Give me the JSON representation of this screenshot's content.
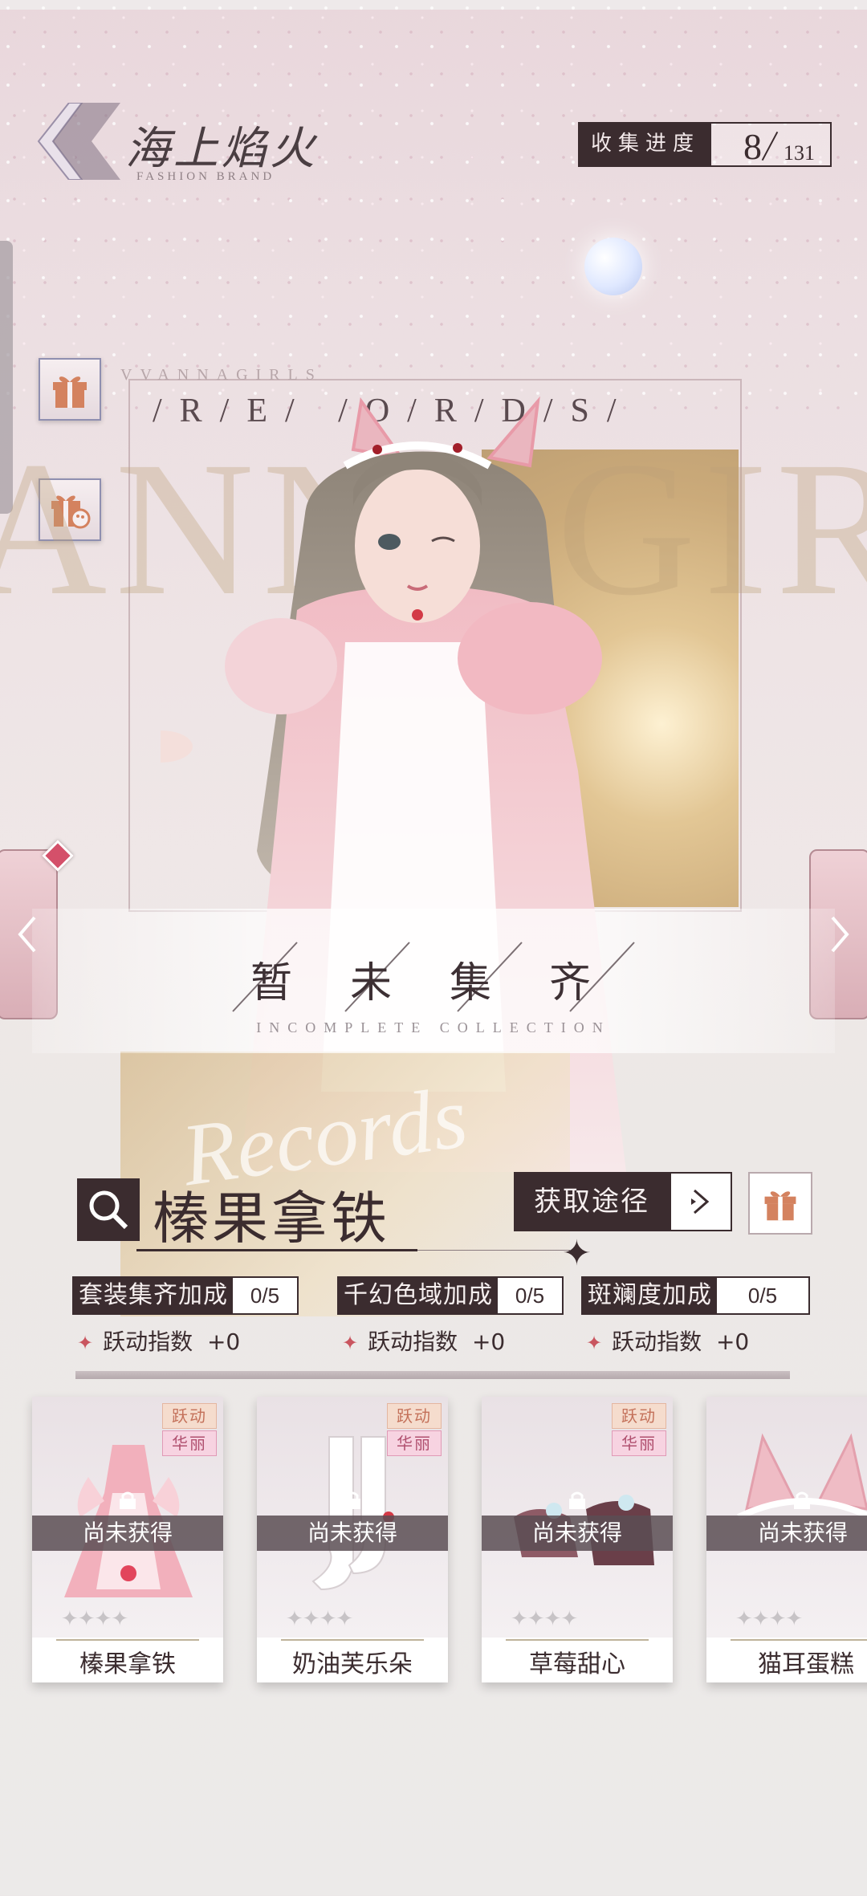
{
  "header": {
    "brand_title": "海上焰火",
    "brand_subtitle": "FASHION BRAND",
    "progress_label": "收集进度",
    "progress_current": "8",
    "progress_total": "131"
  },
  "banner": {
    "top_small": "VVANNAGIRLS",
    "records": "/R/E/ /O/R/D/S/",
    "big_letters": "ANNAGIR",
    "status_title": "暂未集齐",
    "status_subtitle": "INCOMPLETE   COLLECTION",
    "script_word": "Records"
  },
  "suit": {
    "name": "榛果拿铁",
    "obtain_label": "获取途径"
  },
  "bonuses": [
    {
      "label": "套装集齐加成",
      "value": "0/5",
      "sub_label": "跃动指数",
      "sub_value": "+0"
    },
    {
      "label": "千幻色域加成",
      "value": "0/5",
      "sub_label": "跃动指数",
      "sub_value": "+0"
    },
    {
      "label": "斑斓度加成",
      "value": "0/5",
      "sub_label": "跃动指数",
      "sub_value": "+0"
    }
  ],
  "items": [
    {
      "name": "榛果拿铁",
      "tag1": "跃动",
      "tag2": "华丽",
      "status": "尚未获得",
      "stars": "✦✦✦✦"
    },
    {
      "name": "奶油芙乐朵",
      "tag1": "跃动",
      "tag2": "华丽",
      "status": "尚未获得",
      "stars": "✦✦✦✦"
    },
    {
      "name": "草莓甜心",
      "tag1": "跃动",
      "tag2": "华丽",
      "status": "尚未获得",
      "stars": "✦✦✦✦"
    },
    {
      "name": "猫耳蛋糕",
      "status": "尚未获得",
      "stars": "✦✦✦✦"
    }
  ],
  "colors": {
    "dark": "#3b2c2f",
    "accent_pink": "#d9aeb6",
    "gold": "#c7a46e"
  },
  "icons": {
    "back": "back-chevron-icon",
    "gift": "gift-icon",
    "gift_palette": "gift-palette-icon",
    "search": "search-icon",
    "arrow": "chevron-right-icon",
    "lock": "lock-icon"
  }
}
